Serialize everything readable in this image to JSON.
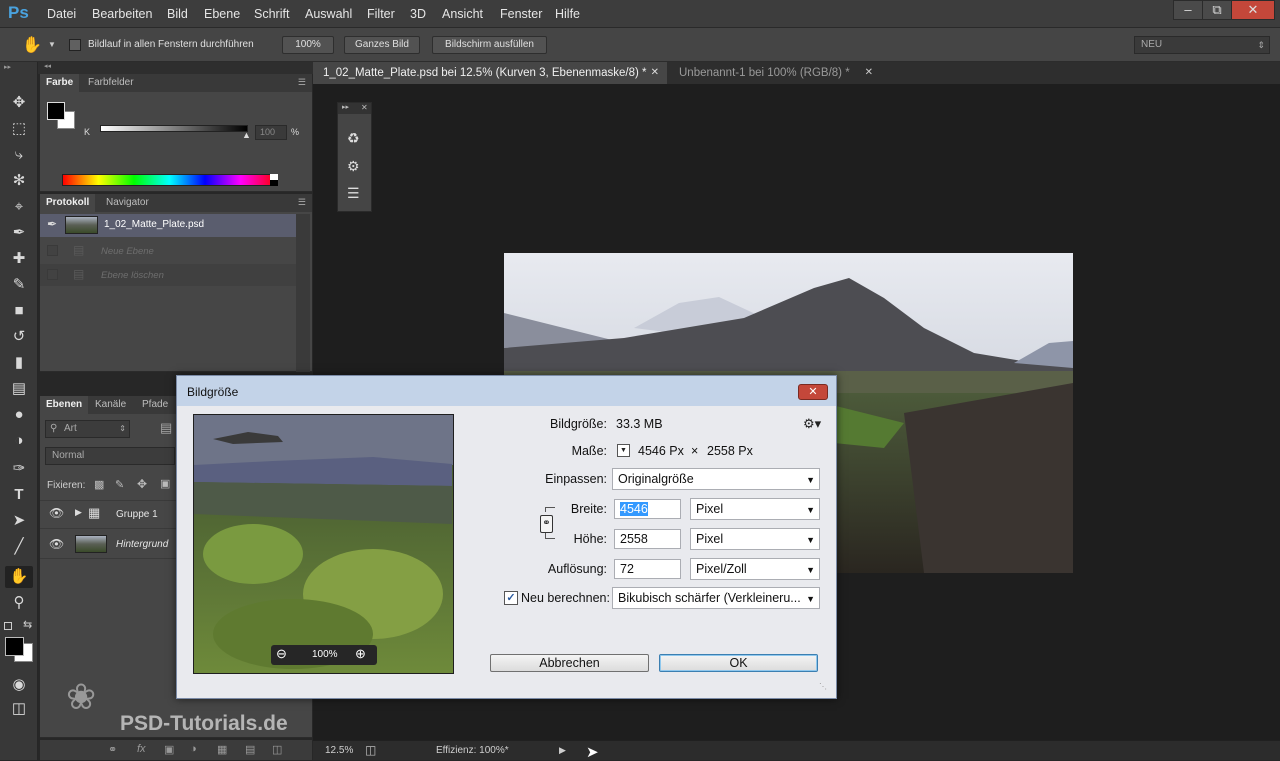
{
  "app": {
    "logo": "Ps"
  },
  "menu": [
    "Datei",
    "Bearbeiten",
    "Bild",
    "Ebene",
    "Schrift",
    "Auswahl",
    "Filter",
    "3D",
    "Ansicht",
    "Fenster",
    "Hilfe"
  ],
  "window_controls": {
    "minimize": "–",
    "restore": "⧉",
    "close": "✕"
  },
  "options": {
    "scroll_all_label": "Bildlauf in allen Fenstern durchführen",
    "btn_100": "100%",
    "btn_fit": "Ganzes Bild",
    "btn_fill": "Bildschirm ausfüllen",
    "workspace": "NEU"
  },
  "doc_tabs": [
    {
      "label": "1_02_Matte_Plate.psd bei 12.5% (Kurven 3, Ebenenmaske/8) *",
      "active": true
    },
    {
      "label": "Unbenannt-1 bei 100% (RGB/8) *",
      "active": false
    }
  ],
  "color_panel": {
    "tabs": [
      "Farbe",
      "Farbfelder"
    ],
    "channel": "K",
    "value": "100",
    "unit": "%"
  },
  "history_panel": {
    "tabs": [
      "Protokoll",
      "Navigator"
    ],
    "snapshot": "1_02_Matte_Plate.psd",
    "items": [
      "Neue Ebene",
      "Ebene löschen"
    ]
  },
  "layers_panel": {
    "tabs": [
      "Ebenen",
      "Kanäle",
      "Pfade"
    ],
    "filter": "Art",
    "blend": "Normal",
    "lock_label": "Fixieren:",
    "layers": [
      {
        "name": "Gruppe 1"
      },
      {
        "name": "Hintergrund"
      }
    ]
  },
  "dialog": {
    "title": "Bildgröße",
    "size_label": "Bildgröße:",
    "size_value": "33.3 MB",
    "dims_label": "Maße:",
    "dims_width": "4546 Px",
    "dims_x": "×",
    "dims_height": "2558 Px",
    "fit_label": "Einpassen:",
    "fit_value": "Originalgröße",
    "width_label": "Breite:",
    "width_value": "4546",
    "width_unit": "Pixel",
    "height_label": "Höhe:",
    "height_value": "2558",
    "height_unit": "Pixel",
    "res_label": "Auflösung:",
    "res_value": "72",
    "res_unit": "Pixel/Zoll",
    "resample_label": "Neu berechnen:",
    "resample_checked": true,
    "resample_value": "Bikubisch schärfer (Verkleineru...",
    "preview_zoom": "100%",
    "cancel": "Abbrechen",
    "ok": "OK"
  },
  "status": {
    "zoom": "12.5%",
    "efficiency": "Effizienz: 100%*"
  },
  "watermark": "PSD-Tutorials.de",
  "colors": {
    "accent": "#4aa3df",
    "dialog_bg": "#e9eaee",
    "close_red": "#c4473a",
    "selection": "#5a5d6e"
  }
}
